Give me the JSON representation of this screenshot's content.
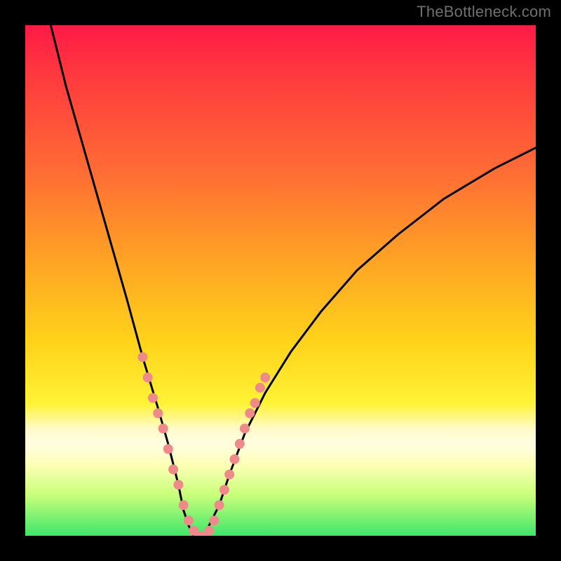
{
  "watermark": "TheBottleneck.com",
  "chart_data": {
    "type": "line",
    "title": "",
    "xlabel": "",
    "ylabel": "",
    "xlim": [
      0,
      100
    ],
    "ylim": [
      0,
      100
    ],
    "series": [
      {
        "name": "bottleneck-curve",
        "x": [
          5,
          8,
          12,
          16,
          20,
          23,
          26,
          28,
          30,
          31,
          32,
          33,
          34,
          35,
          36,
          38,
          40,
          43,
          47,
          52,
          58,
          65,
          73,
          82,
          92,
          100
        ],
        "y": [
          100,
          88,
          74,
          60,
          46,
          35,
          25,
          18,
          10,
          5,
          2,
          0,
          0,
          0,
          2,
          6,
          12,
          20,
          28,
          36,
          44,
          52,
          59,
          66,
          72,
          76
        ]
      }
    ],
    "markers": {
      "name": "highlight-dots",
      "color": "#ef8a8a",
      "points": [
        {
          "x": 23,
          "y": 35
        },
        {
          "x": 24,
          "y": 31
        },
        {
          "x": 25,
          "y": 27
        },
        {
          "x": 26,
          "y": 24
        },
        {
          "x": 27,
          "y": 21
        },
        {
          "x": 28,
          "y": 17
        },
        {
          "x": 29,
          "y": 13
        },
        {
          "x": 30,
          "y": 10
        },
        {
          "x": 31,
          "y": 6
        },
        {
          "x": 32,
          "y": 3
        },
        {
          "x": 33,
          "y": 1
        },
        {
          "x": 34,
          "y": 0
        },
        {
          "x": 35,
          "y": 0
        },
        {
          "x": 36,
          "y": 1
        },
        {
          "x": 37,
          "y": 3
        },
        {
          "x": 38,
          "y": 6
        },
        {
          "x": 39,
          "y": 9
        },
        {
          "x": 40,
          "y": 12
        },
        {
          "x": 41,
          "y": 15
        },
        {
          "x": 42,
          "y": 18
        },
        {
          "x": 43,
          "y": 21
        },
        {
          "x": 44,
          "y": 24
        },
        {
          "x": 45,
          "y": 26
        },
        {
          "x": 46,
          "y": 29
        },
        {
          "x": 47,
          "y": 31
        }
      ]
    },
    "colors": {
      "curve": "#000000",
      "marker": "#ef8a8a",
      "gradient_top": "#ff1a46",
      "gradient_bottom": "#3ee66a",
      "frame": "#000000"
    }
  }
}
